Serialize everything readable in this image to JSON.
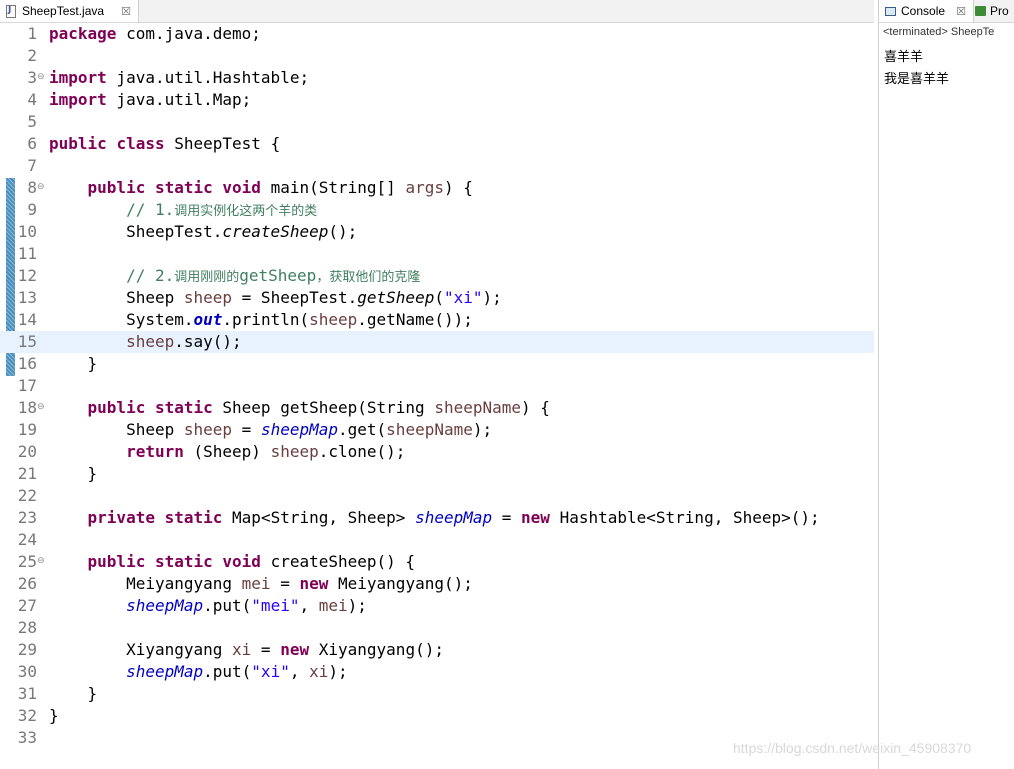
{
  "editor": {
    "tab": {
      "title": "SheepTest.java",
      "icon": "java-file-icon",
      "close_glyph": "☒"
    }
  },
  "code_lines": [
    {
      "n": "1",
      "tokens": [
        [
          "kw",
          "package"
        ],
        [
          "p",
          " com.java.demo;"
        ]
      ]
    },
    {
      "n": "2",
      "tokens": []
    },
    {
      "n": "3",
      "fold": "⊖",
      "tokens": [
        [
          "kw",
          "import"
        ],
        [
          "p",
          " java.util.Hashtable;"
        ]
      ]
    },
    {
      "n": "4",
      "tokens": [
        [
          "kw",
          "import"
        ],
        [
          "p",
          " java.util.Map;"
        ]
      ]
    },
    {
      "n": "5",
      "tokens": []
    },
    {
      "n": "6",
      "tokens": [
        [
          "kw",
          "public"
        ],
        [
          "p",
          " "
        ],
        [
          "kw",
          "class"
        ],
        [
          "p",
          " SheepTest {"
        ]
      ]
    },
    {
      "n": "7",
      "tokens": []
    },
    {
      "n": "8",
      "fold": "⊖",
      "tokens": [
        [
          "p",
          "    "
        ],
        [
          "kw",
          "public"
        ],
        [
          "p",
          " "
        ],
        [
          "kw",
          "static"
        ],
        [
          "p",
          " "
        ],
        [
          "kw",
          "void"
        ],
        [
          "p",
          " main(String[] "
        ],
        [
          "var",
          "args"
        ],
        [
          "p",
          ") {"
        ]
      ]
    },
    {
      "n": "9",
      "tokens": [
        [
          "p",
          "        "
        ],
        [
          "cm",
          "// 1."
        ],
        [
          "cmzh",
          "调用实例化这两个羊的类"
        ]
      ]
    },
    {
      "n": "10",
      "tokens": [
        [
          "p",
          "        SheepTest."
        ],
        [
          "smeth",
          "createSheep"
        ],
        [
          "p",
          "();"
        ]
      ]
    },
    {
      "n": "11",
      "tokens": []
    },
    {
      "n": "12",
      "tokens": [
        [
          "p",
          "        "
        ],
        [
          "cm",
          "// 2."
        ],
        [
          "cmzh",
          "调用刚刚的"
        ],
        [
          "cm",
          "getSheep"
        ],
        [
          "cmzh",
          "，获取他们的克隆"
        ]
      ]
    },
    {
      "n": "13",
      "tokens": [
        [
          "p",
          "        Sheep "
        ],
        [
          "var",
          "sheep"
        ],
        [
          "p",
          " = SheepTest."
        ],
        [
          "smeth",
          "getSheep"
        ],
        [
          "p",
          "("
        ],
        [
          "str",
          "\"xi\""
        ],
        [
          "p",
          ");"
        ]
      ]
    },
    {
      "n": "14",
      "tokens": [
        [
          "p",
          "        System."
        ],
        [
          "sfieldb",
          "out"
        ],
        [
          "p",
          ".println("
        ],
        [
          "var",
          "sheep"
        ],
        [
          "p",
          ".getName());"
        ]
      ]
    },
    {
      "n": "15",
      "current": true,
      "tokens": [
        [
          "p",
          "        "
        ],
        [
          "var",
          "sheep"
        ],
        [
          "p",
          ".say();"
        ]
      ]
    },
    {
      "n": "16",
      "tokens": [
        [
          "p",
          "    }"
        ]
      ]
    },
    {
      "n": "17",
      "tokens": []
    },
    {
      "n": "18",
      "fold": "⊖",
      "tokens": [
        [
          "p",
          "    "
        ],
        [
          "kw",
          "public"
        ],
        [
          "p",
          " "
        ],
        [
          "kw",
          "static"
        ],
        [
          "p",
          " Sheep getSheep(String "
        ],
        [
          "var",
          "sheepName"
        ],
        [
          "p",
          ") {"
        ]
      ]
    },
    {
      "n": "19",
      "tokens": [
        [
          "p",
          "        Sheep "
        ],
        [
          "var",
          "sheep"
        ],
        [
          "p",
          " = "
        ],
        [
          "sfield",
          "sheepMap"
        ],
        [
          "p",
          ".get("
        ],
        [
          "var",
          "sheepName"
        ],
        [
          "p",
          ");"
        ]
      ]
    },
    {
      "n": "20",
      "tokens": [
        [
          "p",
          "        "
        ],
        [
          "kw",
          "return"
        ],
        [
          "p",
          " (Sheep) "
        ],
        [
          "var",
          "sheep"
        ],
        [
          "p",
          ".clone();"
        ]
      ]
    },
    {
      "n": "21",
      "tokens": [
        [
          "p",
          "    }"
        ]
      ]
    },
    {
      "n": "22",
      "tokens": []
    },
    {
      "n": "23",
      "tokens": [
        [
          "p",
          "    "
        ],
        [
          "kw",
          "private"
        ],
        [
          "p",
          " "
        ],
        [
          "kw",
          "static"
        ],
        [
          "p",
          " Map<String, Sheep> "
        ],
        [
          "sfield",
          "sheepMap"
        ],
        [
          "p",
          " = "
        ],
        [
          "kw",
          "new"
        ],
        [
          "p",
          " Hashtable<String, Sheep>();"
        ]
      ]
    },
    {
      "n": "24",
      "tokens": []
    },
    {
      "n": "25",
      "fold": "⊖",
      "tokens": [
        [
          "p",
          "    "
        ],
        [
          "kw",
          "public"
        ],
        [
          "p",
          " "
        ],
        [
          "kw",
          "static"
        ],
        [
          "p",
          " "
        ],
        [
          "kw",
          "void"
        ],
        [
          "p",
          " createSheep() {"
        ]
      ]
    },
    {
      "n": "26",
      "tokens": [
        [
          "p",
          "        Meiyangyang "
        ],
        [
          "var",
          "mei"
        ],
        [
          "p",
          " = "
        ],
        [
          "kw",
          "new"
        ],
        [
          "p",
          " Meiyangyang();"
        ]
      ]
    },
    {
      "n": "27",
      "tokens": [
        [
          "p",
          "        "
        ],
        [
          "sfield",
          "sheepMap"
        ],
        [
          "p",
          ".put("
        ],
        [
          "str",
          "\"mei\""
        ],
        [
          "p",
          ", "
        ],
        [
          "var",
          "mei"
        ],
        [
          "p",
          ");"
        ]
      ]
    },
    {
      "n": "28",
      "tokens": []
    },
    {
      "n": "29",
      "tokens": [
        [
          "p",
          "        Xiyangyang "
        ],
        [
          "var",
          "xi"
        ],
        [
          "p",
          " = "
        ],
        [
          "kw",
          "new"
        ],
        [
          "p",
          " Xiyangyang();"
        ]
      ]
    },
    {
      "n": "30",
      "tokens": [
        [
          "p",
          "        "
        ],
        [
          "sfield",
          "sheepMap"
        ],
        [
          "p",
          ".put("
        ],
        [
          "str",
          "\"xi\""
        ],
        [
          "p",
          ", "
        ],
        [
          "var",
          "xi"
        ],
        [
          "p",
          ");"
        ]
      ]
    },
    {
      "n": "31",
      "tokens": [
        [
          "p",
          "    }"
        ]
      ]
    },
    {
      "n": "32",
      "tokens": [
        [
          "p",
          "}"
        ]
      ]
    },
    {
      "n": "33",
      "tokens": []
    }
  ],
  "console": {
    "tab_label": "Console",
    "tab_close_glyph": "☒",
    "second_tab_label": "Pro",
    "status": "<terminated> SheepTe",
    "output": [
      "喜羊羊",
      "我是喜羊羊"
    ]
  },
  "watermark": "https://blog.csdn.net/weixin_45908370",
  "colors": {
    "keyword": "#7f0055",
    "string": "#2a00ff",
    "comment": "#3f7f5f",
    "local_variable": "#6a3e3e",
    "static_field": "#0000c0",
    "current_line": "#e8f2fe"
  }
}
